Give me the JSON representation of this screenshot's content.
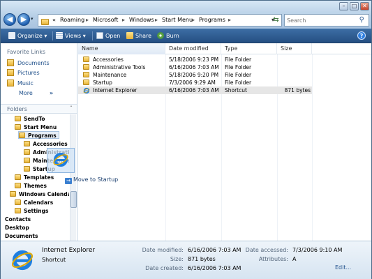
{
  "window": {
    "controls": {
      "minimize": "–",
      "maximize": "□",
      "close": "✕"
    }
  },
  "address": {
    "overflow_glyph": "«",
    "breadcrumb": [
      "Roaming",
      "Microsoft",
      "Windows",
      "Start Menu",
      "Programs"
    ],
    "separator": "▸",
    "search_placeholder": "Search"
  },
  "toolbar": {
    "organize": "Organize",
    "views": "Views",
    "open": "Open",
    "share": "Share",
    "burn": "Burn",
    "dropdown_glyph": "▾"
  },
  "nav": {
    "favorites_header": "Favorite Links",
    "favorites": [
      "Documents",
      "Pictures",
      "Music"
    ],
    "more": "More",
    "more_glyph": "»",
    "folders_header": "Folders",
    "tree": [
      "SendTo",
      "Start Menu",
      "Programs",
      "Accessories",
      "Administrative Tools",
      "Maintenance",
      "Startup",
      "Templates",
      "Themes",
      "Windows Calendar",
      "Calendars",
      "Settings",
      "Contacts",
      "Desktop",
      "Documents"
    ]
  },
  "drag": {
    "tooltip": "Move to Startup"
  },
  "list": {
    "columns": [
      "Name",
      "Date modified",
      "Type",
      "Size"
    ],
    "rows": [
      {
        "name": "Accessories",
        "date": "5/18/2006 9:23 PM",
        "type": "File Folder",
        "size": ""
      },
      {
        "name": "Administrative Tools",
        "date": "6/16/2006 7:03 AM",
        "type": "File Folder",
        "size": ""
      },
      {
        "name": "Maintenance",
        "date": "5/18/2006 9:20 PM",
        "type": "File Folder",
        "size": ""
      },
      {
        "name": "Startup",
        "date": "7/3/2006 9:29 AM",
        "type": "File Folder",
        "size": ""
      },
      {
        "name": "Internet Explorer",
        "date": "6/16/2006 7:03 AM",
        "type": "Shortcut",
        "size": "871 bytes"
      }
    ]
  },
  "details": {
    "name": "Internet Explorer",
    "type": "Shortcut",
    "date_modified_label": "Date modified:",
    "date_modified": "6/16/2006 7:03 AM",
    "size_label": "Size:",
    "size": "871 bytes",
    "date_created_label": "Date created:",
    "date_created": "6/16/2006 7:03 AM",
    "date_accessed_label": "Date accessed:",
    "date_accessed": "7/3/2006 9:10 AM",
    "attributes_label": "Attributes:",
    "attributes": "A",
    "edit": "Edit..."
  },
  "colors": {
    "toolbar_top": "#3d6ea5",
    "toolbar_bottom": "#254f82",
    "link": "#1e4f8a",
    "selection": "#e6e6e6"
  }
}
